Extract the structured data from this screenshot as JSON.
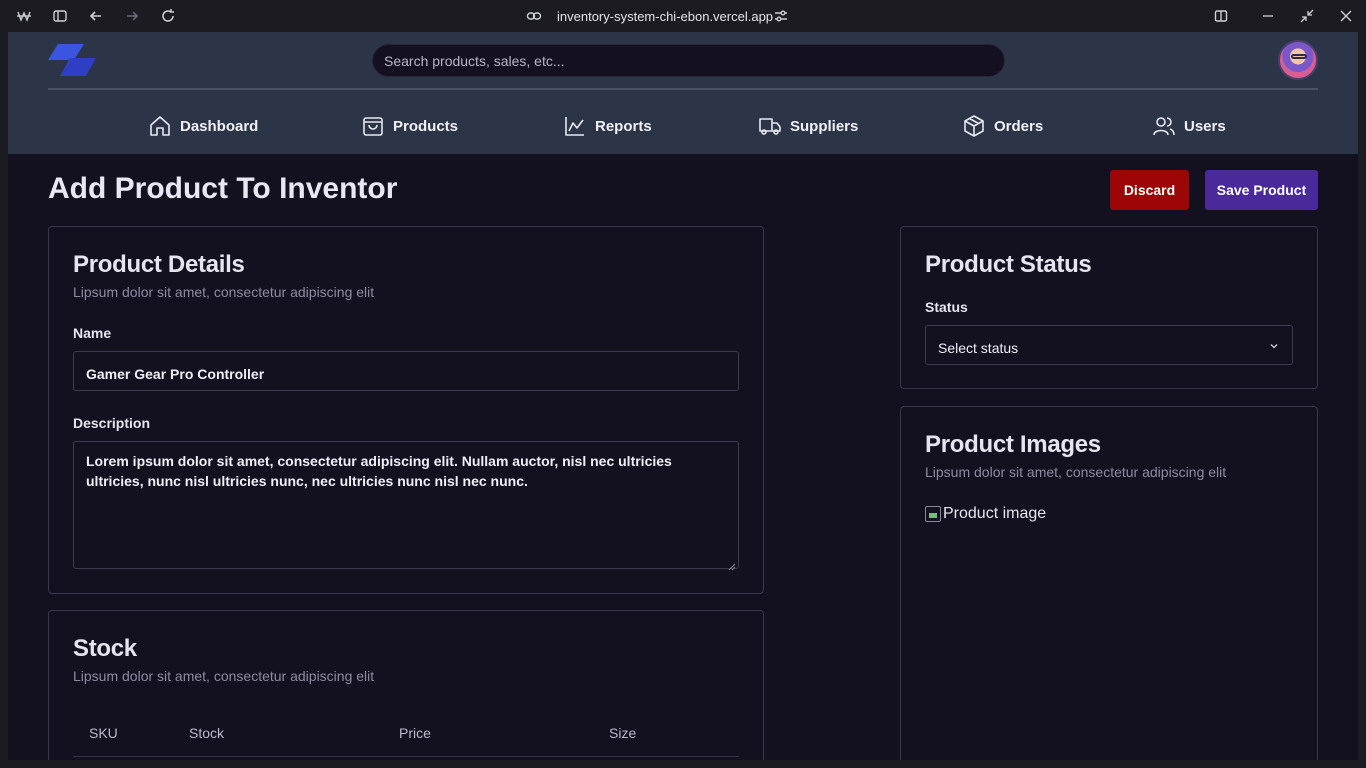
{
  "browser": {
    "url": "inventory-system-chi-ebon.vercel.app"
  },
  "search": {
    "placeholder": "Search products, sales, etc..."
  },
  "nav": {
    "dashboard": "Dashboard",
    "products": "Products",
    "reports": "Reports",
    "suppliers": "Suppliers",
    "orders": "Orders",
    "users": "Users"
  },
  "page": {
    "title": "Add Product To Inventor",
    "discard_label": "Discard",
    "save_label": "Save Product"
  },
  "details": {
    "title": "Product Details",
    "subtitle": "Lipsum dolor sit amet, consectetur adipiscing elit",
    "name_label": "Name",
    "name_value": "Gamer Gear Pro Controller",
    "description_label": "Description",
    "description_value": "Lorem ipsum dolor sit amet, consectetur adipiscing elit. Nullam auctor, nisl nec ultricies ultricies, nunc nisl ultricies nunc, nec ultricies nunc nisl nec nunc."
  },
  "stock": {
    "title": "Stock",
    "subtitle": "Lipsum dolor sit amet, consectetur adipiscing elit",
    "columns": [
      "SKU",
      "Stock",
      "Price",
      "Size"
    ]
  },
  "status": {
    "title": "Product Status",
    "label": "Status",
    "selected": "Select status"
  },
  "images": {
    "title": "Product Images",
    "subtitle": "Lipsum dolor sit amet, consectetur adipiscing elit",
    "alt_text": "Product image"
  },
  "colors": {
    "discard": "#9c0606",
    "save": "#4a2a9a",
    "topbar": "#2c3548",
    "background": "#13101f"
  }
}
